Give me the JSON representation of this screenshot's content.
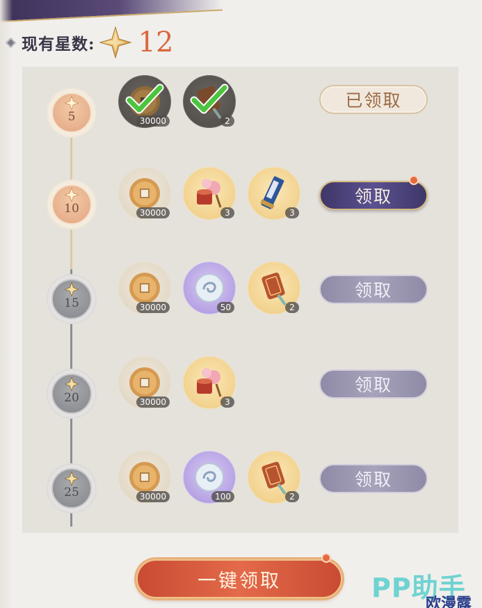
{
  "header": {
    "label": "现有星数:",
    "count": "12",
    "bullet_icon": "diamond-bullet-icon",
    "star_icon": "four-point-star-icon"
  },
  "colors": {
    "count_orange": "#d9683e",
    "claim_button_purple": "#4a4278",
    "locked_button_gray": "#9a96b0",
    "claim_all_red": "#d6583b",
    "reached_node_peach": "#e9b08c",
    "locked_node_gray": "#8d8e95"
  },
  "tiers": [
    {
      "level": "5",
      "status": "claimed",
      "button_label": "已领取",
      "items": [
        {
          "icon": "copper-coin-icon",
          "qty": "30000",
          "claimed": true
        },
        {
          "icon": "tassel-token-icon",
          "qty": "2",
          "claimed": true
        }
      ]
    },
    {
      "level": "10",
      "status": "claimable",
      "button_label": "领取",
      "items": [
        {
          "icon": "copper-coin-icon",
          "qty": "30000"
        },
        {
          "icon": "flower-drum-bundle-icon",
          "qty": "3"
        },
        {
          "icon": "blue-scroll-icon",
          "qty": "3"
        }
      ]
    },
    {
      "level": "15",
      "status": "locked",
      "button_label": "领取",
      "items": [
        {
          "icon": "copper-coin-icon",
          "qty": "30000"
        },
        {
          "icon": "swirl-jade-disc-icon",
          "qty": "50"
        },
        {
          "icon": "tassel-token-icon",
          "qty": "2"
        }
      ]
    },
    {
      "level": "20",
      "status": "locked",
      "button_label": "领取",
      "items": [
        {
          "icon": "copper-coin-icon",
          "qty": "30000"
        },
        {
          "icon": "flower-drum-bundle-icon",
          "qty": "3"
        }
      ]
    },
    {
      "level": "25",
      "status": "locked",
      "button_label": "领取",
      "items": [
        {
          "icon": "copper-coin-icon",
          "qty": "30000"
        },
        {
          "icon": "swirl-jade-disc-icon",
          "qty": "100"
        },
        {
          "icon": "tassel-token-icon",
          "qty": "2"
        }
      ]
    }
  ],
  "claim_all_label": "一键领取",
  "watermark": {
    "brand": "PP助手",
    "site": "欧漫露"
  }
}
